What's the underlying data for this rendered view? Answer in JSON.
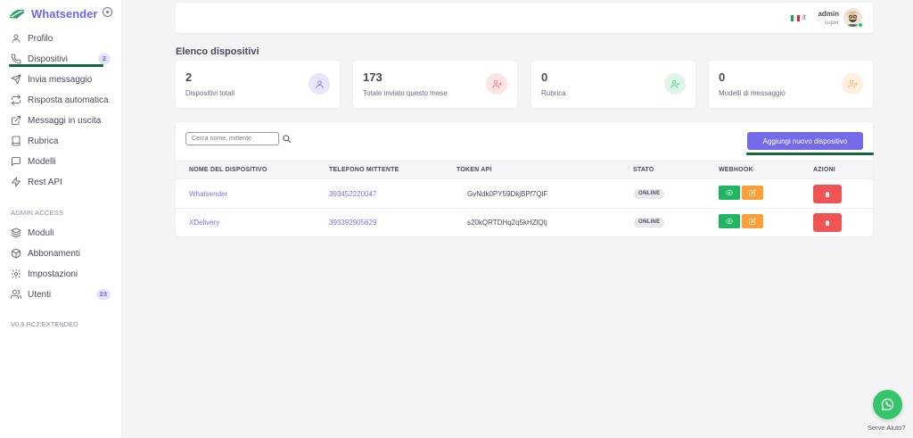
{
  "brand": {
    "name": "Whatsender"
  },
  "sidebar": {
    "items": [
      {
        "label": "Profilo",
        "icon": "user-icon"
      },
      {
        "label": "Dispositivi",
        "icon": "phone-icon",
        "badge": "2"
      },
      {
        "label": "Invia messaggio",
        "icon": "send-icon"
      },
      {
        "label": "Risposta automatica",
        "icon": "repeat-icon"
      },
      {
        "label": "Messaggi in uscita",
        "icon": "external-link-icon"
      },
      {
        "label": "Rubrica",
        "icon": "book-icon"
      },
      {
        "label": "Modelli",
        "icon": "message-square-icon"
      },
      {
        "label": "Rest API",
        "icon": "zap-icon"
      }
    ],
    "admin_section_label": "ADMIN ACCESS",
    "admin_items": [
      {
        "label": "Moduli",
        "icon": "layers-icon"
      },
      {
        "label": "Abbonamenti",
        "icon": "package-icon"
      },
      {
        "label": "Impostazioni",
        "icon": "settings-icon"
      },
      {
        "label": "Utenti",
        "icon": "users-icon",
        "badge": "23"
      }
    ],
    "version": "V0.9.RC2:EXTENDED"
  },
  "header": {
    "language": "it",
    "user_name": "admin",
    "user_role": "super"
  },
  "page": {
    "title": "Elenco dispositivi"
  },
  "cards": [
    {
      "value": "2",
      "label": "Dispositivi totali",
      "icon": "user-icon",
      "color": "#7367f0"
    },
    {
      "value": "173",
      "label": "Totale inviato questo mese",
      "icon": "user-plus-icon",
      "color": "#ea5455"
    },
    {
      "value": "0",
      "label": "Rubrica",
      "icon": "user-check-icon",
      "color": "#28c76f"
    },
    {
      "value": "0",
      "label": "Modelli di messaggio",
      "icon": "user-plus-icon",
      "color": "#ff9f43"
    }
  ],
  "devices": {
    "search_placeholder": "Cerca nome, mittente",
    "add_button": "Aggiungi nuovo dispositivo",
    "columns": [
      "NOME DEL DISPOSITIVO",
      "TELEFONO MITTENTE",
      "TOKEN API",
      "STATO",
      "WEBHOOK",
      "AZIONI"
    ],
    "rows": [
      {
        "name": "Whatsender",
        "phone": "393452220047",
        "token": "GvNdk0PY59DkjBPf7QlF",
        "status": "ONLINE"
      },
      {
        "name": "XDelivery",
        "phone": "393392905629",
        "token": "s20kQRTDHq2q5kHZlQtj",
        "status": "ONLINE"
      }
    ]
  },
  "help": {
    "label": "Serve Aiuto?"
  },
  "colors": {
    "primary": "#736be8",
    "success": "#28c76f",
    "warning": "#ff9f43",
    "danger": "#ee5454",
    "underline": "#11663d"
  }
}
